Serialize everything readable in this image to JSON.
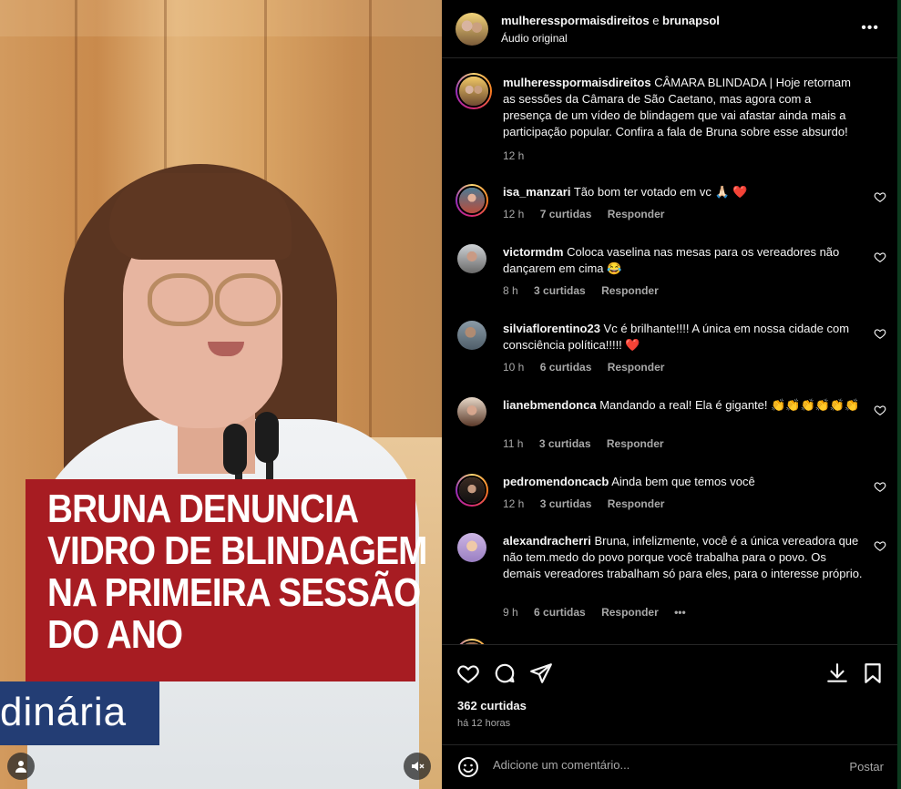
{
  "video": {
    "headline_lines": [
      "BRUNA DENUNCIA",
      "VIDRO DE BLINDAGEM",
      "NA PRIMEIRA SESSÃO",
      "DO ANO"
    ],
    "lower_third_text": "dinária"
  },
  "header": {
    "user1": "mulheresspormaisdireitos",
    "connector": "e",
    "user2": "brunapsol",
    "audio_label": "Áudio original",
    "more_icon": "more-horizontal-icon"
  },
  "caption": {
    "username": "mulheresspormaisdireitos",
    "text": "CÂMARA BLINDADA | Hoje retornam as sessões da Câmara de São Caetano, mas agora com a presença de um vídeo de blindagem que vai afastar ainda mais a participação popular. Confira a fala de Bruna sobre esse absurdo!",
    "time": "12 h"
  },
  "comments": [
    {
      "username": "isa_manzari",
      "text": "Tão bom ter votado em vc 🙏🏻 ❤️",
      "time": "12 h",
      "likes": "7 curtidas",
      "reply": "Responder"
    },
    {
      "username": "victormdm",
      "text": "Coloca vaselina nas mesas para os vereadores não dançarem em cima 😂",
      "time": "8 h",
      "likes": "3 curtidas",
      "reply": "Responder"
    },
    {
      "username": "silviaflorentino23",
      "text": "Vc é brilhante!!!! A única em nossa cidade com consciência política!!!!! ❤️",
      "time": "10 h",
      "likes": "6 curtidas",
      "reply": "Responder"
    },
    {
      "username": "lianebmendonca",
      "text": "Mandando a real! Ela é gigante! 👏👏👏👏👏👏",
      "time": "11 h",
      "likes": "3 curtidas",
      "reply": "Responder"
    },
    {
      "username": "pedromendoncacb",
      "text": "Ainda bem que temos você",
      "time": "12 h",
      "likes": "3 curtidas",
      "reply": "Responder"
    },
    {
      "username": "alexandracherri",
      "text": "Bruna, infelizmente, você é a única vereadora que não tem.medo do povo porque você trabalha para o povo. Os demais vereadores trabalham só para eles, para o interesse próprio.",
      "time": "9 h",
      "likes": "6 curtidas",
      "reply": "Responder",
      "more": "•••"
    }
  ],
  "footer": {
    "likes": "362 curtidas",
    "when": "há 12 horas",
    "comment_placeholder": "Adicione um comentário...",
    "post_label": "Postar"
  },
  "colors": {
    "panel_bg": "#000000",
    "text": "#f5f5f5",
    "muted": "#a8a8a8",
    "divider": "#262626",
    "headline_red": "#a71c22",
    "lower_third_blue": "#233d74"
  }
}
